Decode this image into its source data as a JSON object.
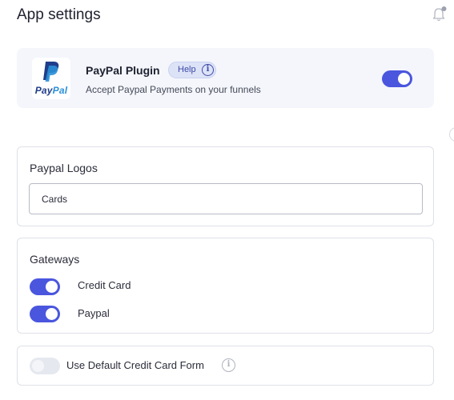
{
  "header": {
    "title": "App settings",
    "notification_icon": "bell-icon"
  },
  "plugin": {
    "logo_text_pay": "Pay",
    "logo_text_pal": "Pal",
    "name": "PayPal Plugin",
    "help_label": "Help",
    "help_icon": "info-icon",
    "description": "Accept Paypal Payments on your funnels",
    "enabled": true
  },
  "logos": {
    "title": "Paypal Logos",
    "value": "Cards"
  },
  "gateways": {
    "title": "Gateways",
    "items": [
      {
        "label": "Credit Card",
        "enabled": true
      },
      {
        "label": "Paypal",
        "enabled": true
      }
    ]
  },
  "default_form": {
    "label": "Use Default Credit Card Form",
    "enabled": false,
    "info_icon": "info-icon"
  },
  "colors": {
    "accent": "#4a56de",
    "card_bg": "#f4f6fc",
    "paypal_dark": "#1f3d8a",
    "paypal_light": "#2a8fd6"
  }
}
